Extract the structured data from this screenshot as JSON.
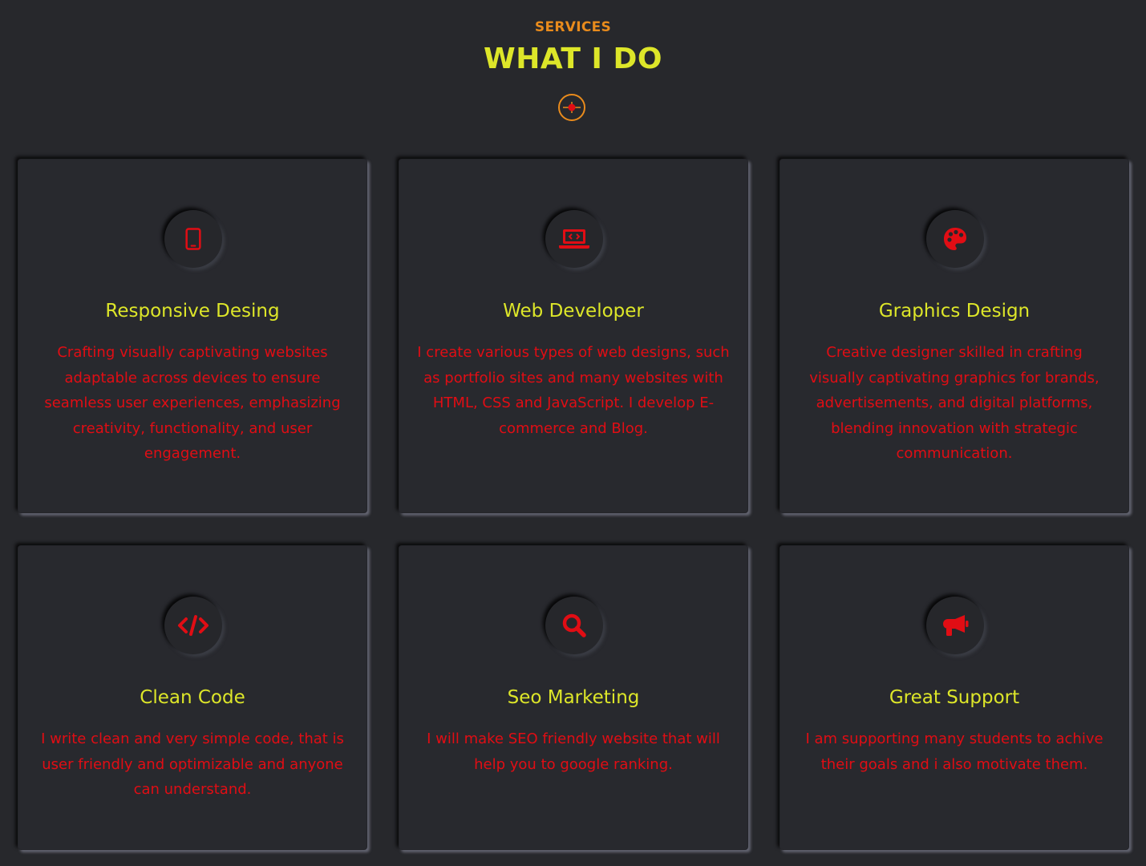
{
  "header": {
    "eyebrow": "SERVICES",
    "title": "WHAT I DO"
  },
  "colors": {
    "background": "#27282c",
    "eyebrow": "#e98b1c",
    "title": "#dde629",
    "icon": "#e10d14",
    "body_text": "#e10d14"
  },
  "services": [
    {
      "icon": "mobile-icon",
      "title": "Responsive Desing",
      "description": "Crafting visually captivating websites adaptable across devices to ensure seamless user experiences, emphasizing creativity, functionality, and user engagement."
    },
    {
      "icon": "laptop-code-icon",
      "title": "Web Developer",
      "description": "I create various types of web designs, such as portfolio sites and many websites with HTML, CSS and JavaScript. I develop E-commerce and Blog."
    },
    {
      "icon": "palette-icon",
      "title": "Graphics Design",
      "description": "Creative designer skilled in crafting visually captivating graphics for brands, advertisements, and digital platforms, blending innovation with strategic communication."
    },
    {
      "icon": "code-icon",
      "title": "Clean Code",
      "description": "I write clean and very simple code, that is user friendly and optimizable and anyone can understand."
    },
    {
      "icon": "search-icon",
      "title": "Seo Marketing",
      "description": "I will make SEO friendly website that will help you to google ranking."
    },
    {
      "icon": "megaphone-icon",
      "title": "Great Support",
      "description": "I am supporting many students to achive their goals and i also motivate them."
    }
  ]
}
